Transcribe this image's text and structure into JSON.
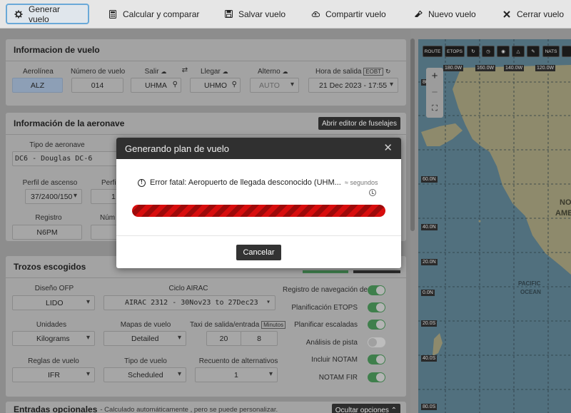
{
  "toolbar": {
    "items": [
      {
        "label": "Generar vuelo",
        "icon": "gear-icon"
      },
      {
        "label": "Calcular y comparar",
        "icon": "calculator-icon"
      },
      {
        "label": "Salvar vuelo",
        "icon": "save-icon"
      },
      {
        "label": "Compartir vuelo",
        "icon": "cloud-upload-icon"
      },
      {
        "label": "Nuevo vuelo",
        "icon": "eraser-icon"
      },
      {
        "label": "Cerrar vuelo",
        "icon": "close-icon"
      }
    ]
  },
  "flight_info": {
    "title": "Informacion de vuelo",
    "airline_label": "Aerolínea",
    "airline_value": "ALZ",
    "flight_number_label": "Número de vuelo",
    "flight_number_value": "014",
    "departure_label": "Salir",
    "departure_value": "UHMA",
    "arrival_label": "Llegar",
    "arrival_value": "UHMO",
    "alternate_label": "Alterno",
    "alternate_value": "AUTO",
    "departure_time_label": "Hora de salida",
    "eobt_badge": "EOBT",
    "departure_time_value": "21 Dec 2023 - 17:55"
  },
  "aircraft_info": {
    "title": "Información de la aeronave",
    "fuselage_button": "Abrir editor de fuselajes",
    "type_label": "Tipo de aeronave",
    "type_value": "DC6 - Douglas DC-6",
    "climb_label": "Perfil de ascenso",
    "climb_value": "37/2400/150",
    "cruise_label": "Perfi",
    "cruise_value": "1",
    "registration_label": "Registro",
    "registration_value": "N6PM",
    "number_label": "Núm"
  },
  "chosen_parts": {
    "title": "Trozos escogidos",
    "ofp_label": "Diseño OFP",
    "ofp_value": "LIDO",
    "airac_label": "Ciclo AIRAC",
    "airac_value": "AIRAC 2312 - 30Nov23 to 27Dec23",
    "units_label": "Unidades",
    "units_value": "Kilograms",
    "maps_label": "Mapas de vuelo",
    "maps_value": "Detailed",
    "taxi_label": "Taxi de salida/entrada",
    "taxi_unit": "Minutos",
    "taxi_out": "20",
    "taxi_sep": "/",
    "taxi_in": "8",
    "rules_label": "Reglas de vuelo",
    "rules_value": "IFR",
    "flight_type_label": "Tipo de vuelo",
    "flight_type_value": "Scheduled",
    "alternates_label": "Recuento de alternativos",
    "alternates_value": "1",
    "toggles": [
      {
        "label": "Registro de navegación de",
        "on": true
      },
      {
        "label": "Planificación ETOPS",
        "on": true
      },
      {
        "label": "Planificar escaladas",
        "on": true
      },
      {
        "label": "Análisis de pista",
        "on": false
      },
      {
        "label": "Incluir NOTAM",
        "on": true
      },
      {
        "label": "NOTAM FIR",
        "on": true
      }
    ]
  },
  "optional_entries": {
    "title": "Entradas opcionales",
    "subtitle": "- Calculado automáticamente , pero se puede personalizar.",
    "hide_button": "Ocultar opciones"
  },
  "map": {
    "tools": [
      "ROUTE",
      "ETOPS",
      "",
      "",
      "",
      "",
      "",
      "NATS",
      ""
    ],
    "longitudes": [
      "180.0W",
      "160.0W",
      "140.0W",
      "120.0W"
    ],
    "latitudes": [
      "80.0N",
      "60.0N",
      "40.0N",
      "20.0N",
      "0.0N",
      "20.0S",
      "40.0S",
      "80.0S"
    ],
    "labels": [
      "NO",
      "AME",
      "PACIFIC",
      "OCEAN"
    ],
    "zoom_in": "+",
    "zoom_out": "−"
  },
  "modal": {
    "title": "Generando plan de vuelo",
    "error_text": "Error fatal: Aeropuerto de llegada desconocido (UHM...",
    "seconds_label": "segundos",
    "progress": 1.0,
    "cancel_label": "Cancelar"
  },
  "colors": {
    "progress": "#d80d0d",
    "toggle_on": "#3f7f4c",
    "modal_header": "#303030"
  }
}
